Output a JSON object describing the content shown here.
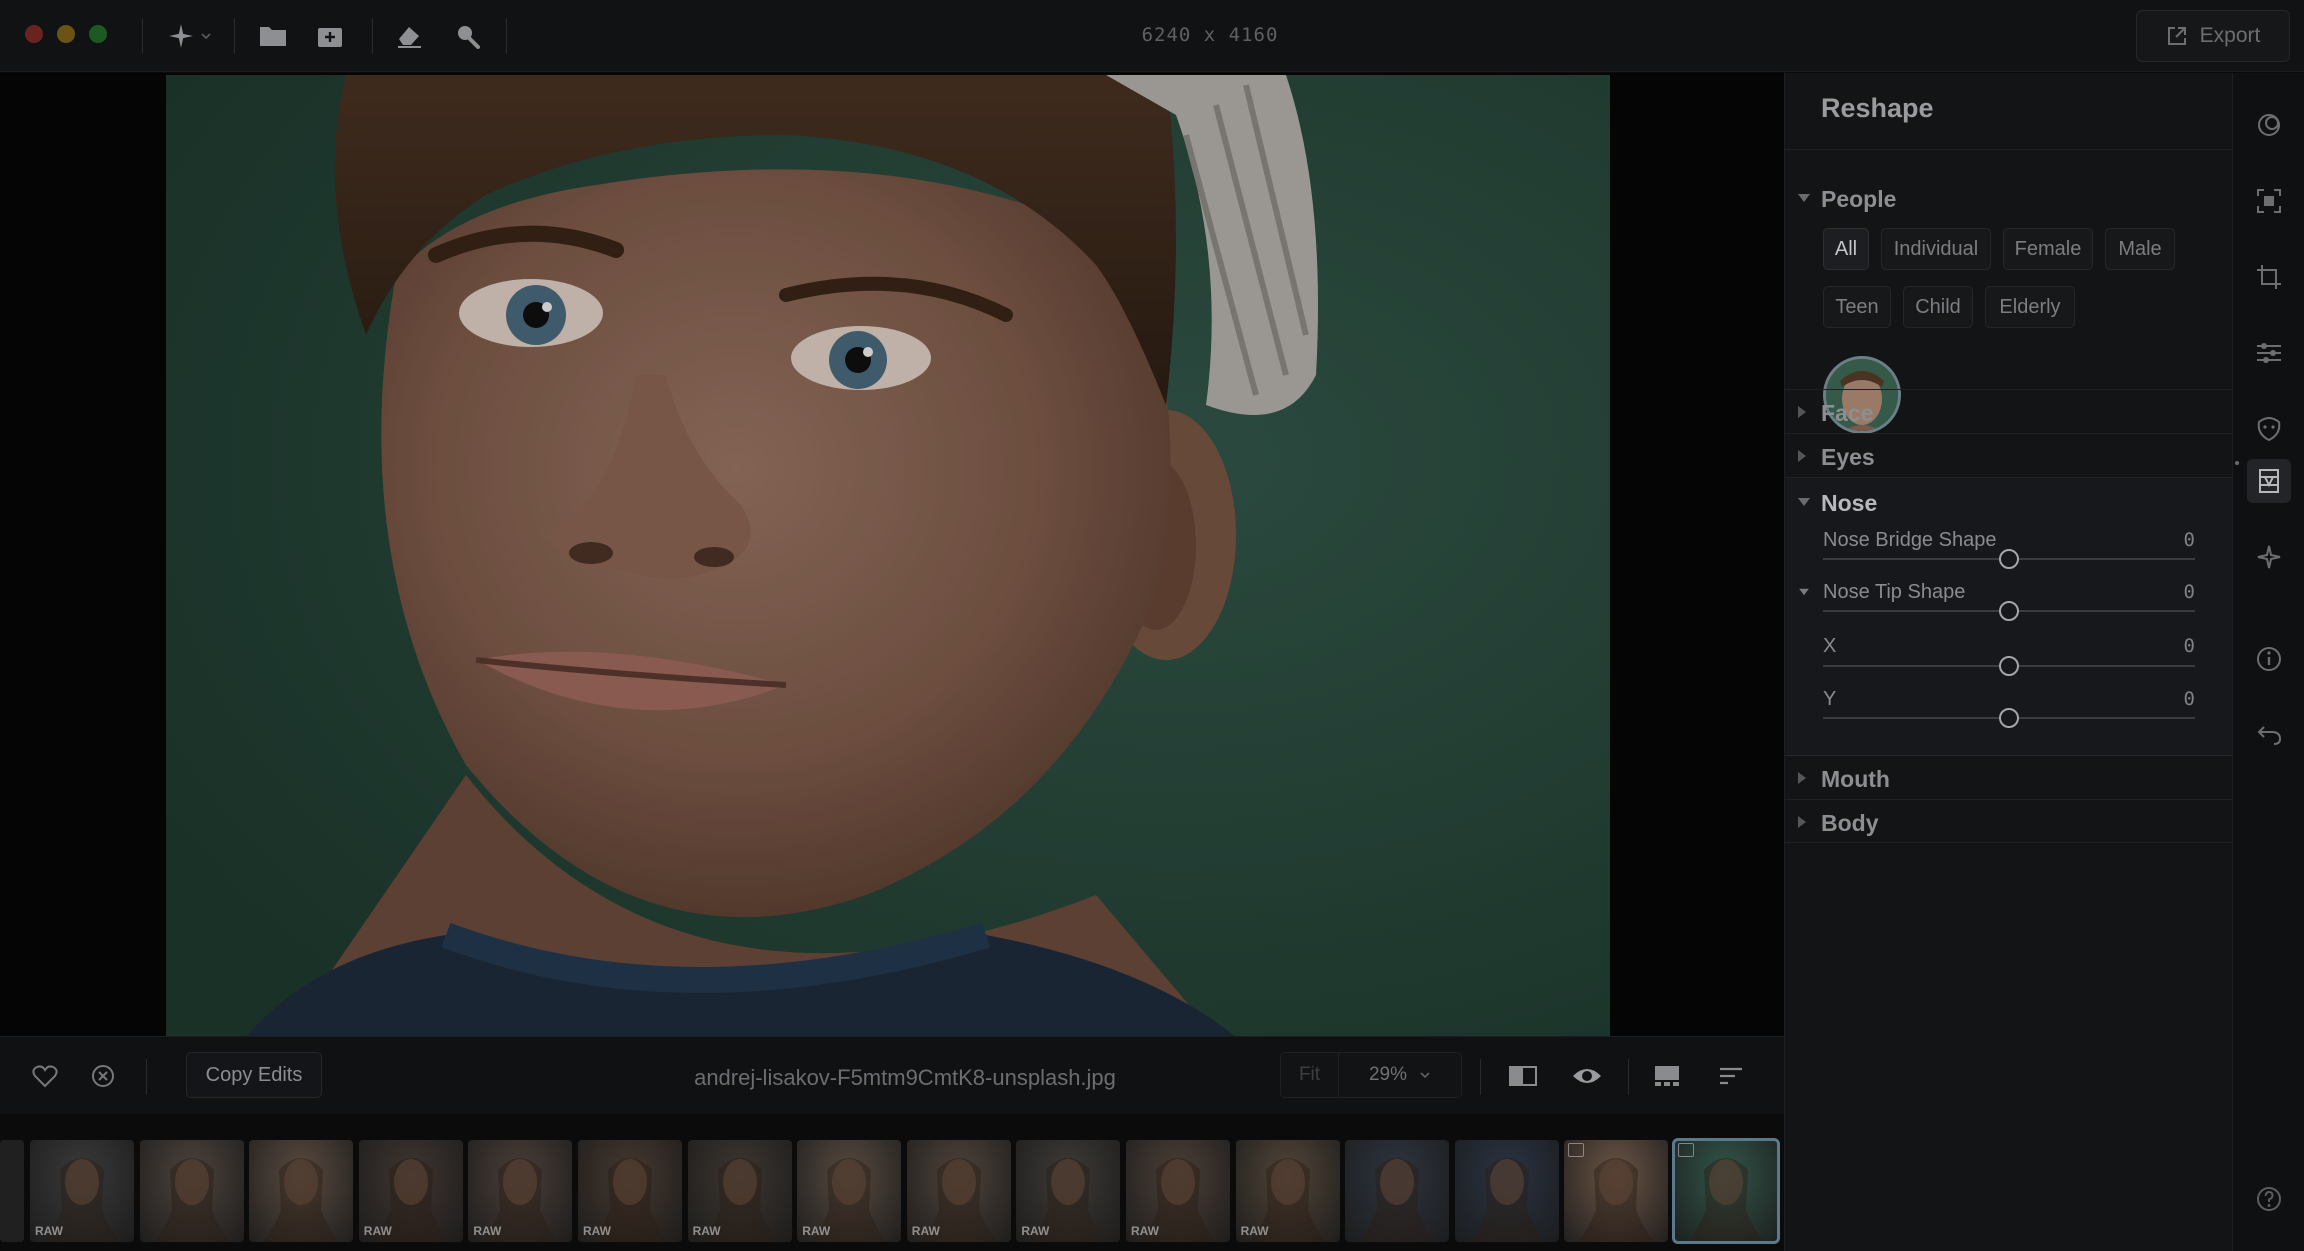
{
  "titlebar": {
    "dimensions": "6240 x 4160",
    "export_label": "Export",
    "colors": {
      "close": "#6b2320",
      "minimize": "#6b5316",
      "maximize": "#1d5a22"
    }
  },
  "toolbar": {
    "icons": [
      "ai-magic-icon",
      "chevron-down-icon",
      "folder-icon",
      "add-image-icon",
      "eraser-icon",
      "search-icon"
    ]
  },
  "infobar": {
    "copy_edits_label": "Copy Edits",
    "filename": "andrej-lisakov-F5mtm9CmtK8-unsplash.jpg",
    "zoom_fit": "Fit",
    "zoom_value": "29%"
  },
  "filmstrip": {
    "thumbs": [
      {
        "raw": "RAW",
        "bg": "#3a3a3a"
      },
      {
        "raw": "",
        "bg": "#4d433c"
      },
      {
        "raw": "",
        "bg": "#5a4b40"
      },
      {
        "raw": "RAW",
        "bg": "#3f3531"
      },
      {
        "raw": "RAW",
        "bg": "#4a3e38"
      },
      {
        "raw": "RAW",
        "bg": "#45382f"
      },
      {
        "raw": "RAW",
        "bg": "#3d3630"
      },
      {
        "raw": "RAW",
        "bg": "#574a40"
      },
      {
        "raw": "RAW",
        "bg": "#4f433a"
      },
      {
        "raw": "RAW",
        "bg": "#3e3a36"
      },
      {
        "raw": "RAW",
        "bg": "#4c3f37"
      },
      {
        "raw": "RAW",
        "bg": "#524538"
      },
      {
        "raw": "",
        "bg": "#2e3540"
      },
      {
        "raw": "",
        "bg": "#2a3444"
      },
      {
        "raw": "",
        "bg": "#6b5546",
        "edited": true
      },
      {
        "raw": "",
        "bg": "#33564a",
        "edited": true,
        "selected": true
      }
    ]
  },
  "panel": {
    "title": "Reshape",
    "people": {
      "title": "People",
      "filters_row1": [
        "All",
        "Individual",
        "Female",
        "Male"
      ],
      "filters_row2": [
        "Teen",
        "Child",
        "Elderly"
      ]
    },
    "face": "Face",
    "eyes": "Eyes",
    "nose": {
      "title": "Nose",
      "sliders": [
        {
          "label": "Nose Bridge Shape",
          "value": "0"
        },
        {
          "label": "Nose Tip Shape",
          "value": "0"
        },
        {
          "label": "X",
          "value": "0"
        },
        {
          "label": "Y",
          "value": "0"
        }
      ]
    },
    "mouth": "Mouth",
    "body": "Body"
  },
  "rail": {
    "icons": [
      "mask-icon",
      "select-subject-icon",
      "crop-icon",
      "sliders-icon",
      "face-retouch-icon",
      "reshape-icon",
      "ai-enhance-icon",
      "info-icon",
      "undo-icon",
      "help-icon"
    ]
  }
}
